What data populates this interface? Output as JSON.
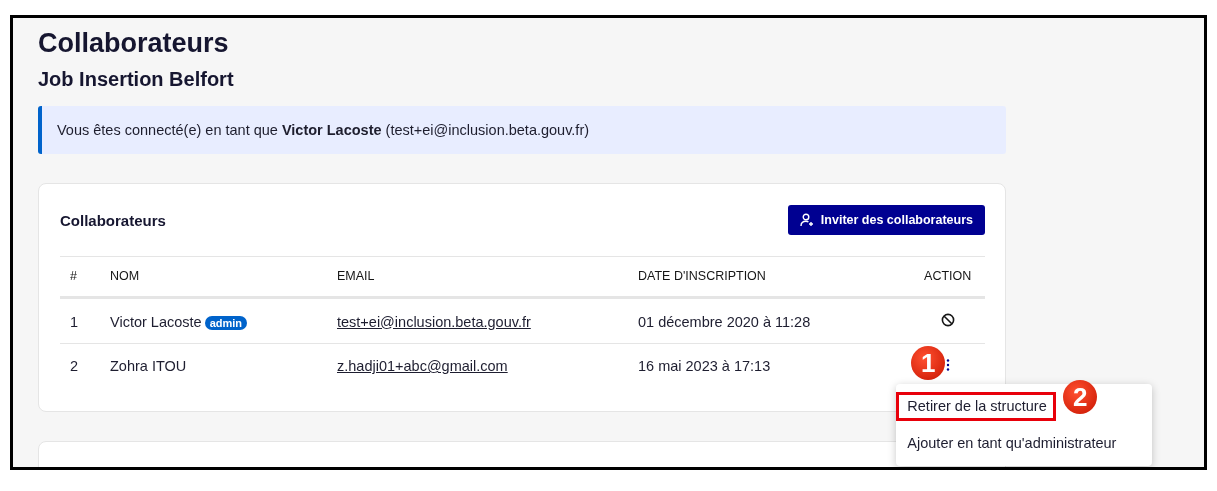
{
  "page": {
    "title": "Collaborateurs",
    "subtitle": "Job Insertion Belfort"
  },
  "alert": {
    "text": "Vous êtes connecté(e) en tant que **Victor Lacoste** (test+ei@inclusion.beta.gouv.fr)"
  },
  "card": {
    "title": "Collaborateurs",
    "button": "Inviter des collaborateurs"
  },
  "table": {
    "columns": [
      "#",
      "NOM",
      "EMAIL",
      "DATE D'INSCRIPTION",
      "ACTION"
    ],
    "rows": [
      {
        "index": "1",
        "name": "Victor Lacoste",
        "badge": "admin",
        "email": "test+ei@inclusion.beta.gouv.fr",
        "date": "01 décembre 2020 à 11:28",
        "kind": "block"
      },
      {
        "index": "2",
        "name": "Zohra ITOU",
        "email": "z.hadji01+abc@gmail.com",
        "date": "16 mai 2023 à 17:13",
        "kind": "more"
      }
    ]
  },
  "menu": {
    "items": [
      {
        "label": "Retirer de la structure",
        "highlighted": true
      },
      {
        "label": "Ajouter en tant qu'administrateur",
        "highlighted": false
      }
    ]
  },
  "callouts": [
    "1",
    "2"
  ]
}
